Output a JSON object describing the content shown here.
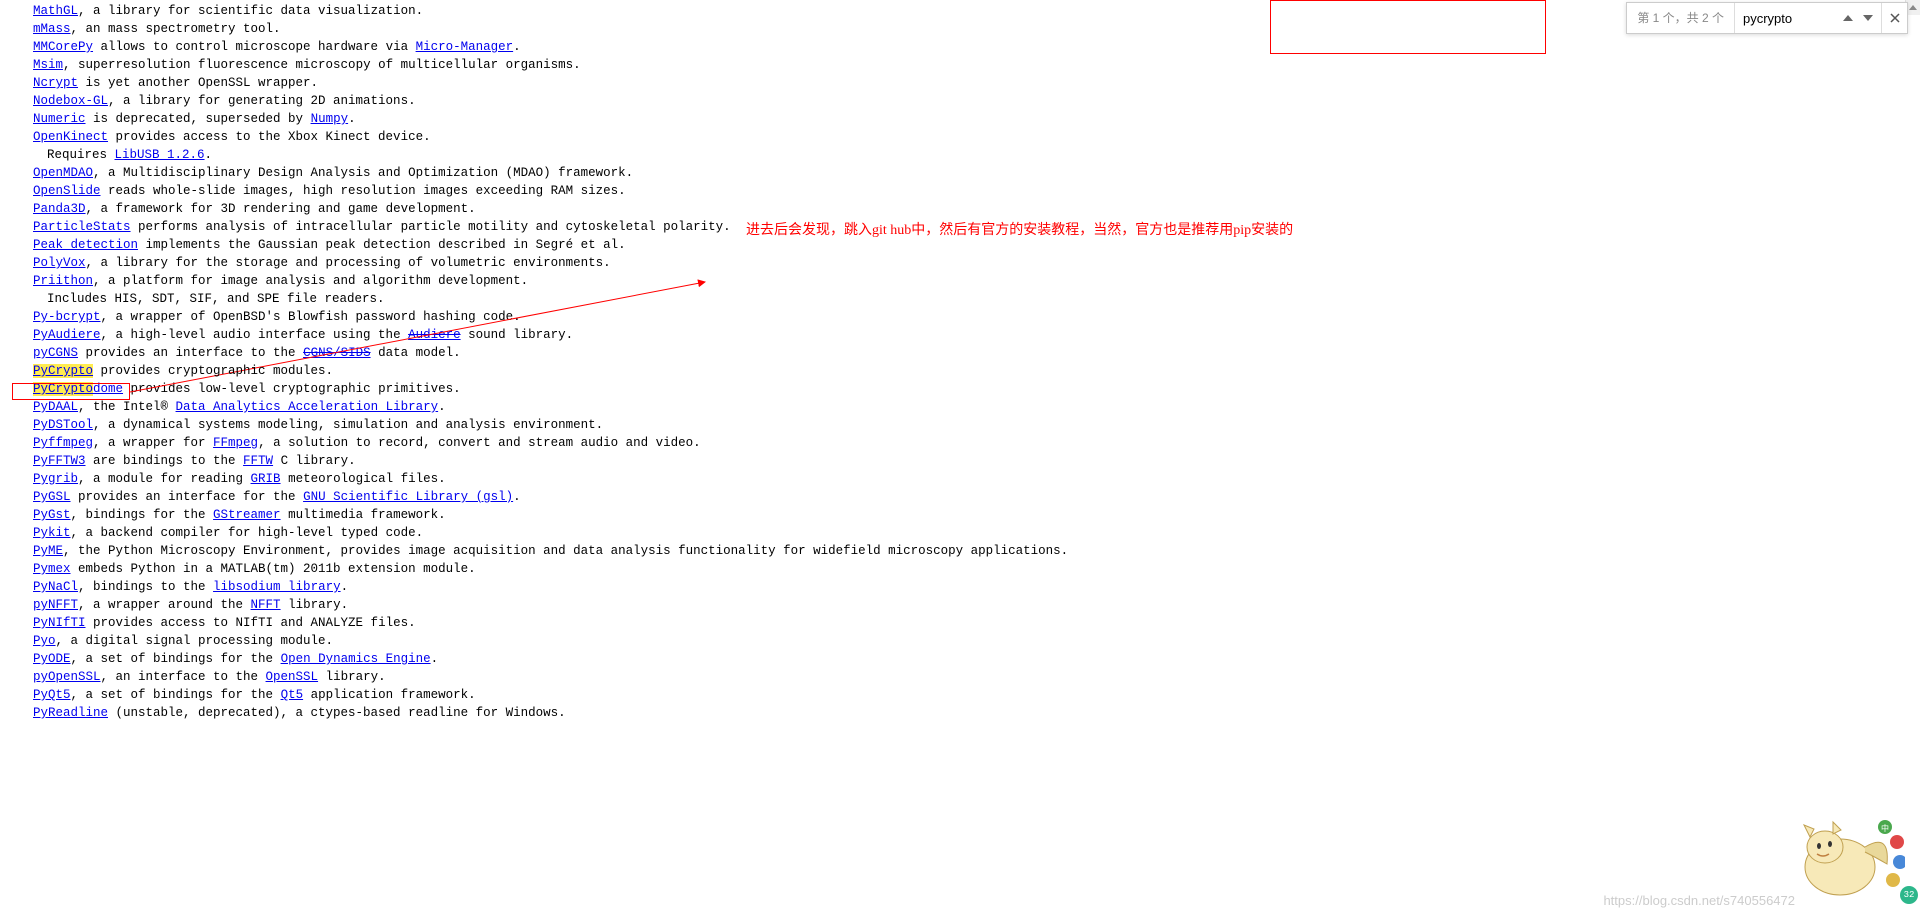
{
  "find": {
    "count": "第 1 个，共 2 个",
    "query": "pycrypto"
  },
  "annotation": "进去后会发现，跳入git hub中，然后有官方的安装教程，当然，官方也是推荐用pip安装的",
  "watermark": "https://blog.csdn.net/s740556472",
  "badge": "32",
  "items": [
    {
      "link": "MathGL",
      "text": ", a library for scientific data visualization."
    },
    {
      "link": "mMass",
      "text": ", an mass spectrometry tool."
    },
    {
      "link": "MMCorePy",
      "text": " allows to control microscope hardware via ",
      "link2": "Micro-Manager",
      "tail": "."
    },
    {
      "link": "Msim",
      "text": ", superresolution fluorescence microscopy of multicellular organisms."
    },
    {
      "link": "Ncrypt",
      "text": " is yet another OpenSSL wrapper."
    },
    {
      "link": "Nodebox-GL",
      "text": ", a library for generating 2D animations."
    },
    {
      "link": "Numeric",
      "text": " is deprecated, superseded by ",
      "link2": "Numpy",
      "tail": "."
    },
    {
      "link": "OpenKinect",
      "text": " provides access to the Xbox Kinect device."
    },
    {
      "sub": true,
      "plain": "Requires ",
      "link2": "LibUSB 1.2.6",
      "tail": "."
    },
    {
      "link": "OpenMDAO",
      "text": ", a Multidisciplinary Design Analysis and Optimization (MDAO) framework."
    },
    {
      "link": "OpenSlide",
      "text": " reads whole-slide images, high resolution images exceeding RAM sizes."
    },
    {
      "link": "Panda3D",
      "text": ", a framework for 3D rendering and game development."
    },
    {
      "link": "ParticleStats",
      "text": " performs analysis of intracellular particle motility and cytoskeletal polarity."
    },
    {
      "link": "Peak detection",
      "text": " implements the Gaussian peak detection described in Segré et al."
    },
    {
      "link": "PolyVox",
      "text": ", a library for the storage and processing of volumetric environments."
    },
    {
      "link": "Priithon",
      "text": ", a platform for image analysis and algorithm development."
    },
    {
      "sub": true,
      "plain": "Includes HIS, SDT, SIF, and SPE file readers."
    },
    {
      "link": "Py-bcrypt",
      "text": ", a wrapper of OpenBSD's Blowfish password hashing code."
    },
    {
      "link": "PyAudiere",
      "text": ", a high-level audio interface using the ",
      "link2": "Audiere",
      "tail": " sound library.",
      "strike2": true
    },
    {
      "link": "pyCGNS",
      "text": " provides an interface to the ",
      "link2": "CGNS/SIDS",
      "tail": " data model.",
      "strike2": true
    },
    {
      "link": "PyCrypto",
      "hlLink": true,
      "text": " provides cryptographic modules.",
      "strikeText": true
    },
    {
      "link": "PyCryptodome",
      "hlPart": "PyCrypto",
      "hlRest": "dome",
      "text": " provides low-level cryptographic primitives."
    },
    {
      "link": "PyDAAL",
      "text": ", the Intel® ",
      "link2": "Data Analytics Acceleration Library",
      "tail": "."
    },
    {
      "link": "PyDSTool",
      "text": ", a dynamical systems modeling, simulation and analysis environment."
    },
    {
      "link": "Pyffmpeg",
      "text": ", a wrapper for ",
      "link2": "FFmpeg",
      "tail": ", a solution to record, convert and stream audio and video."
    },
    {
      "link": "PyFFTW3",
      "text": " are bindings to the ",
      "link2": "FFTW",
      "tail": " C library."
    },
    {
      "link": "Pygrib",
      "text": ", a module for reading ",
      "link2": "GRIB",
      "tail": " meteorological files."
    },
    {
      "link": "PyGSL",
      "text": " provides an interface for the ",
      "link2": "GNU Scientific Library (gsl)",
      "tail": "."
    },
    {
      "link": "PyGst",
      "text": ", bindings for the ",
      "link2": "GStreamer",
      "tail": " multimedia framework."
    },
    {
      "link": "Pykit",
      "text": ", a backend compiler for high-level typed code."
    },
    {
      "link": "PyME",
      "text": ", the Python Microscopy Environment, provides image acquisition and data analysis functionality for widefield microscopy applications."
    },
    {
      "link": "Pymex",
      "text": " embeds Python in a MATLAB(tm) 2011b extension module."
    },
    {
      "link": "PyNaCl",
      "text": ", bindings to the ",
      "link2": "libsodium library",
      "tail": "."
    },
    {
      "link": "pyNFFT",
      "text": ", a wrapper around the ",
      "link2": "NFFT",
      "tail": " library."
    },
    {
      "link": "PyNIfTI",
      "text": " provides access to NIfTI and ANALYZE files."
    },
    {
      "link": "Pyo",
      "text": ", a digital signal processing module."
    },
    {
      "link": "PyODE",
      "text": ", a set of bindings for the ",
      "link2": "Open Dynamics Engine",
      "tail": "."
    },
    {
      "link": "pyOpenSSL",
      "text": ", an interface to the ",
      "link2": "OpenSSL",
      "tail": " library."
    },
    {
      "link": "PyQt5",
      "text": ", a set of bindings for the ",
      "link2": "Qt5",
      "tail": " application framework."
    },
    {
      "link": "PyReadline",
      "text": " (unstable, deprecated), a ctypes-based readline for Windows."
    }
  ]
}
